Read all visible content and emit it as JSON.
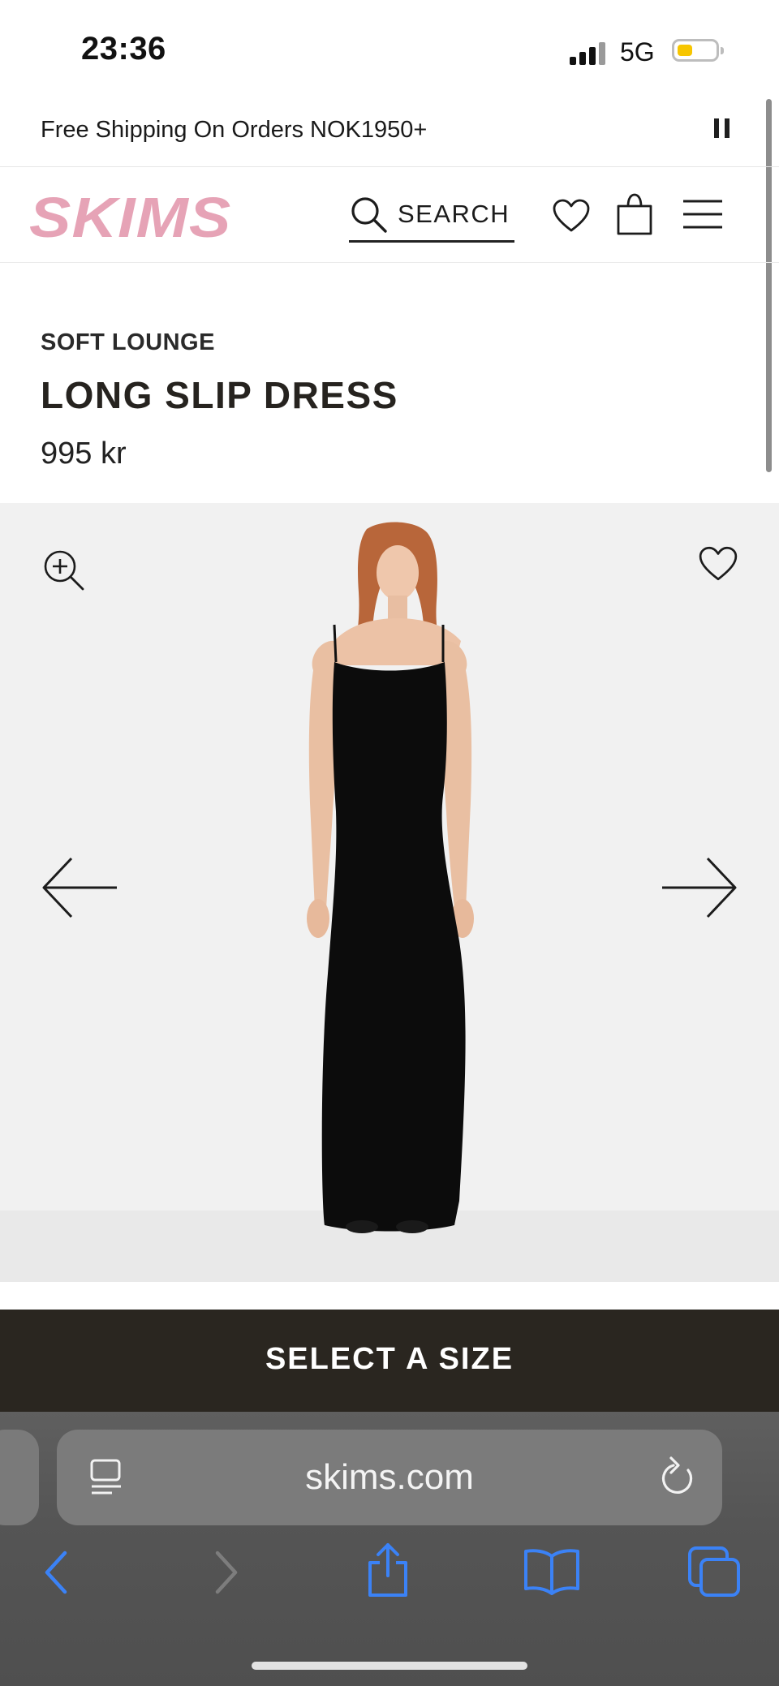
{
  "status_bar": {
    "time": "23:36",
    "network": "5G"
  },
  "promo": {
    "text": "Free Shipping On Orders NOK1950+"
  },
  "header": {
    "logo": "SKIMS",
    "search_label": "SEARCH"
  },
  "product": {
    "collection": "SOFT LOUNGE",
    "title": "LONG SLIP DRESS",
    "price": "995 kr"
  },
  "cta": {
    "label": "SELECT A SIZE"
  },
  "browser": {
    "url": "skims.com"
  },
  "colors": {
    "logo_pink": "#e6a3b6",
    "cta_bg": "#2a2620",
    "safari_blue": "#3b82f6",
    "battery_yellow": "#f7c600"
  },
  "icons": {
    "header": [
      "search-icon",
      "heart-icon",
      "bag-icon",
      "menu-icon"
    ],
    "gallery": [
      "zoom-in-icon",
      "heart-icon",
      "arrow-left-icon",
      "arrow-right-icon"
    ],
    "browser": [
      "reader-icon",
      "reload-icon",
      "back-icon",
      "forward-icon",
      "share-icon",
      "bookmarks-icon",
      "tabs-icon"
    ]
  }
}
